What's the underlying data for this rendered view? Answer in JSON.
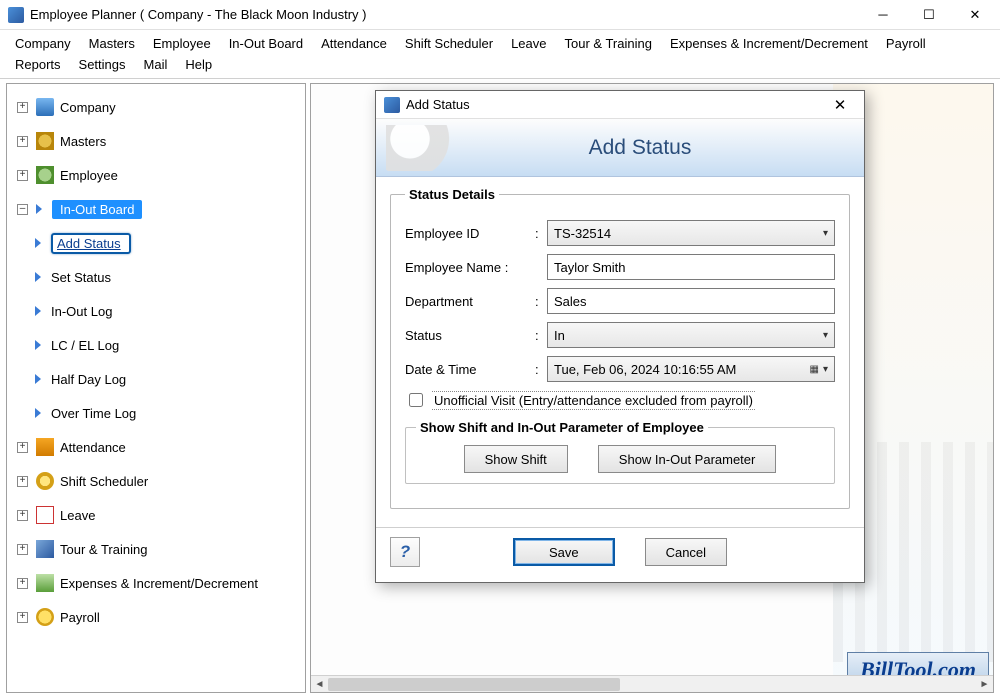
{
  "window": {
    "title": "Employee Planner ( Company - The Black Moon Industry )"
  },
  "menu": [
    "Company",
    "Masters",
    "Employee",
    "In-Out Board",
    "Attendance",
    "Shift Scheduler",
    "Leave",
    "Tour & Training",
    "Expenses & Increment/Decrement",
    "Payroll",
    "Reports",
    "Settings",
    "Mail",
    "Help"
  ],
  "tree": {
    "items": [
      {
        "label": "Company",
        "icon": "ic-company"
      },
      {
        "label": "Masters",
        "icon": "ic-masters"
      },
      {
        "label": "Employee",
        "icon": "ic-employee"
      },
      {
        "label": "In-Out Board",
        "icon": "ic-inout",
        "selected": true,
        "children": [
          {
            "label": "Add Status",
            "selected": true
          },
          {
            "label": "Set Status"
          },
          {
            "label": "In-Out Log"
          },
          {
            "label": "LC / EL Log"
          },
          {
            "label": "Half Day Log"
          },
          {
            "label": "Over Time Log"
          }
        ]
      },
      {
        "label": "Attendance",
        "icon": "ic-attendance"
      },
      {
        "label": "Shift Scheduler",
        "icon": "ic-shift"
      },
      {
        "label": "Leave",
        "icon": "ic-leave"
      },
      {
        "label": "Tour & Training",
        "icon": "ic-tour"
      },
      {
        "label": "Expenses & Increment/Decrement",
        "icon": "ic-exp"
      },
      {
        "label": "Payroll",
        "icon": "ic-payroll"
      }
    ]
  },
  "dialog": {
    "title": "Add Status",
    "banner_title": "Add Status",
    "fieldset_legend": "Status Details",
    "labels": {
      "employee_id": "Employee ID",
      "employee_name": "Employee Name :",
      "department": "Department",
      "status": "Status",
      "datetime": "Date & Time"
    },
    "values": {
      "employee_id": "TS-32514",
      "employee_name": "Taylor Smith",
      "department": "Sales",
      "status": "In",
      "datetime": "Tue, Feb 06, 2024 10:16:55 AM"
    },
    "checkbox_label": "Unofficial Visit (Entry/attendance excluded from payroll)",
    "inner_legend": "Show Shift and In-Out Parameter of Employee",
    "buttons": {
      "show_shift": "Show Shift",
      "show_inout": "Show In-Out Parameter",
      "save": "Save",
      "cancel": "Cancel"
    }
  },
  "watermark": "BillTool.com"
}
